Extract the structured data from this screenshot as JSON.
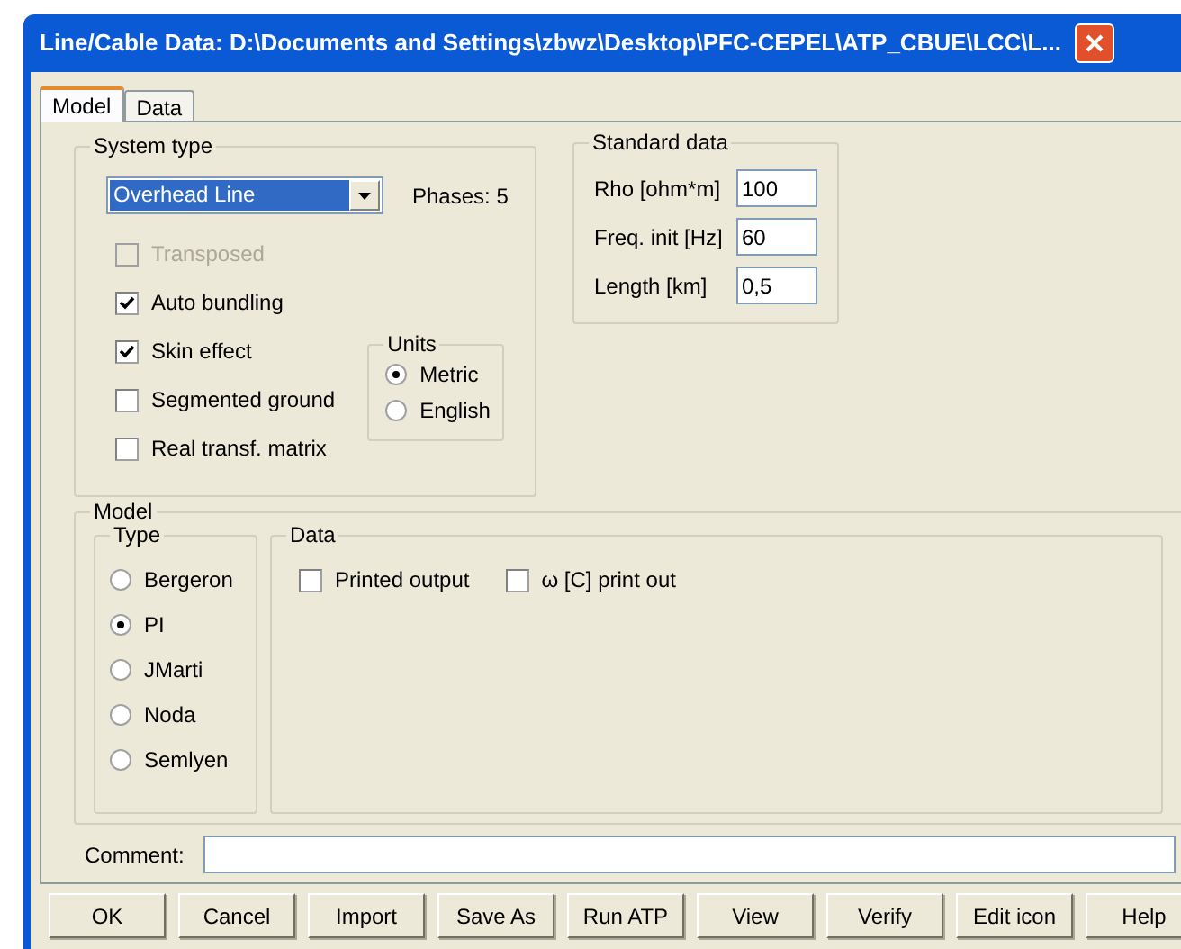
{
  "window": {
    "title": "Line/Cable Data: D:\\Documents and Settings\\zbwz\\Desktop\\PFC-CEPEL\\ATP_CBUE\\LCC\\L..."
  },
  "tabs": [
    {
      "label": "Model",
      "selected": true
    },
    {
      "label": "Data",
      "selected": false
    }
  ],
  "system_type": {
    "title": "System type",
    "dropdown": {
      "value": "Overhead Line"
    },
    "phases": "Phases: 5",
    "options": [
      {
        "label": "Transposed",
        "checked": false,
        "disabled": true
      },
      {
        "label": "Auto bundling",
        "checked": true,
        "disabled": false
      },
      {
        "label": "Skin effect",
        "checked": true,
        "disabled": false
      },
      {
        "label": "Segmented ground",
        "checked": false,
        "disabled": false
      },
      {
        "label": "Real transf. matrix",
        "checked": false,
        "disabled": false
      }
    ],
    "units": {
      "title": "Units",
      "options": [
        {
          "label": "Metric",
          "selected": true
        },
        {
          "label": "English",
          "selected": false
        }
      ]
    }
  },
  "standard_data": {
    "title": "Standard data",
    "fields": [
      {
        "label": "Rho [ohm*m]",
        "value": "100"
      },
      {
        "label": "Freq. init [Hz]",
        "value": "60"
      },
      {
        "label": "Length [km]",
        "value": "0,5"
      }
    ]
  },
  "model": {
    "title": "Model",
    "type": {
      "title": "Type",
      "options": [
        {
          "label": "Bergeron",
          "selected": false
        },
        {
          "label": "PI",
          "selected": true
        },
        {
          "label": "JMarti",
          "selected": false
        },
        {
          "label": "Noda",
          "selected": false
        },
        {
          "label": "Semlyen",
          "selected": false
        }
      ]
    },
    "data": {
      "title": "Data",
      "options": [
        {
          "label": "Printed output",
          "checked": false
        },
        {
          "label": "ω [C] print out",
          "checked": false
        }
      ]
    }
  },
  "comment": {
    "label": "Comment:"
  },
  "buttons": [
    "OK",
    "Cancel",
    "Import",
    "Save As",
    "Run ATP",
    "View",
    "Verify",
    "Edit icon",
    "Help"
  ]
}
